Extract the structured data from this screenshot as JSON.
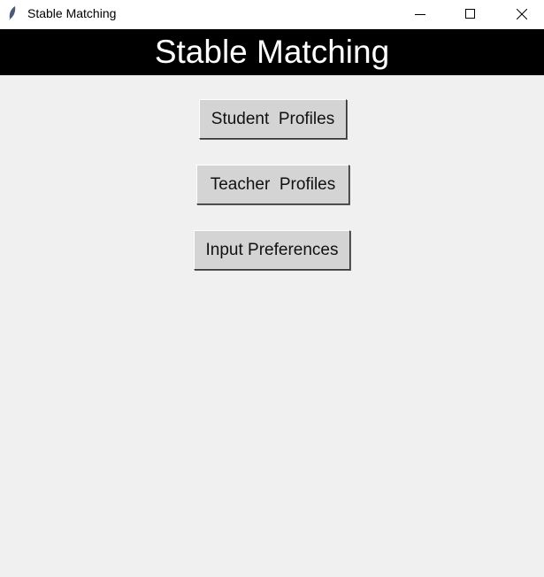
{
  "window": {
    "title": "Stable Matching"
  },
  "header": {
    "title": "Stable Matching"
  },
  "buttons": [
    {
      "label": "Student  Profiles"
    },
    {
      "label": "Teacher  Profiles"
    },
    {
      "label": "Input Preferences"
    }
  ]
}
